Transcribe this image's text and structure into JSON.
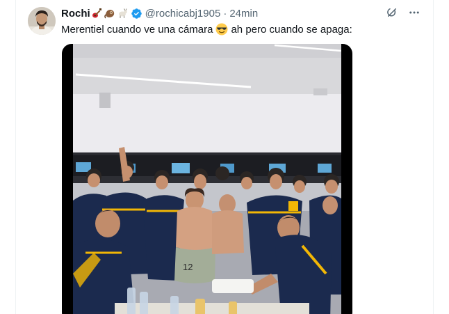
{
  "tweet": {
    "author": {
      "display_name": "Rochi",
      "name_emojis": [
        "guitar-emoji",
        "sloth-emoji",
        "goat-emoji"
      ],
      "verified": true,
      "handle": "@rochicabj1905",
      "separator": "·",
      "timestamp": "24min"
    },
    "text_before": "Merentiel cuando ve una cámara",
    "text_emoji": "smiling-face-with-sunglasses-emoji",
    "text_after": "ah pero cuando se apaga:",
    "media": {
      "type": "video",
      "jersey_number": "12"
    }
  },
  "colors": {
    "text_primary": "#0f1419",
    "text_secondary": "#536471",
    "verified_blue": "#1d9bf0",
    "border": "#eff3f4",
    "boca_navy": "#1b2a4e",
    "boca_gold": "#f2b705"
  },
  "icons": {
    "grok": "grok-icon",
    "more": "more-icon",
    "verified": "verified-badge-icon"
  }
}
